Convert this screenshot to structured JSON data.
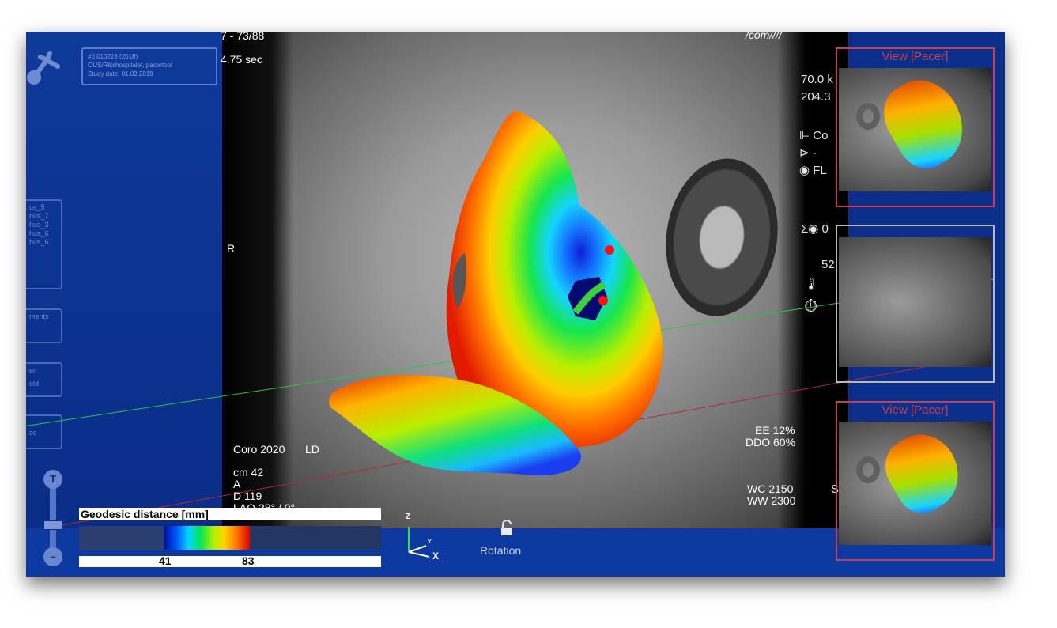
{
  "viewer": {
    "frame_counter": "7 - 73/88",
    "time": "4.75 sec",
    "top_label": "/com////",
    "orientation_left": "R",
    "protocol": "Coro 2020",
    "protocol_sub": "LD",
    "geometry": [
      "cm 42",
      "A",
      "D 119",
      "LAO 28° / 0°"
    ],
    "ee": "EE 12%",
    "ddo": "DDO 60%",
    "wc": "WC 2150",
    "ww": "WW 2300"
  },
  "patient": {
    "line1": "#0 010228 (2018)",
    "line2": "OUS/Rikshospitalet, pacertool",
    "line3": "Study date: 01.02.2018"
  },
  "sidebar": {
    "list": [
      "us_5",
      "hus_7",
      "hus_3",
      "hus_6",
      "hus_6"
    ],
    "box2": "ments",
    "box3_a": "er",
    "box3_b": "old",
    "box4": "ce"
  },
  "slider": {
    "top_label": "T"
  },
  "legend": {
    "title": "Geodesic distance [mm]",
    "min": "41",
    "max": "83"
  },
  "axis": {
    "z": "Z",
    "y": "Y",
    "x": "X"
  },
  "rotation": {
    "label": "Rotation",
    "icon": "unlock-icon"
  },
  "right_panel": {
    "kv": "70.0 k",
    "ma": "204.3",
    "con": "Co",
    "dash": "-",
    "fl": "FL",
    "sum": "0",
    "val": "52",
    "s": "S"
  },
  "thumbnails": [
    {
      "title": "View [Pacer]"
    },
    {
      "title": ""
    },
    {
      "title": "View [Pacer]"
    }
  ],
  "colors": {
    "background": "#0b2f8a",
    "thumb_border_active": "#c9404a",
    "thumb_border_inactive": "#b9b9b9"
  }
}
